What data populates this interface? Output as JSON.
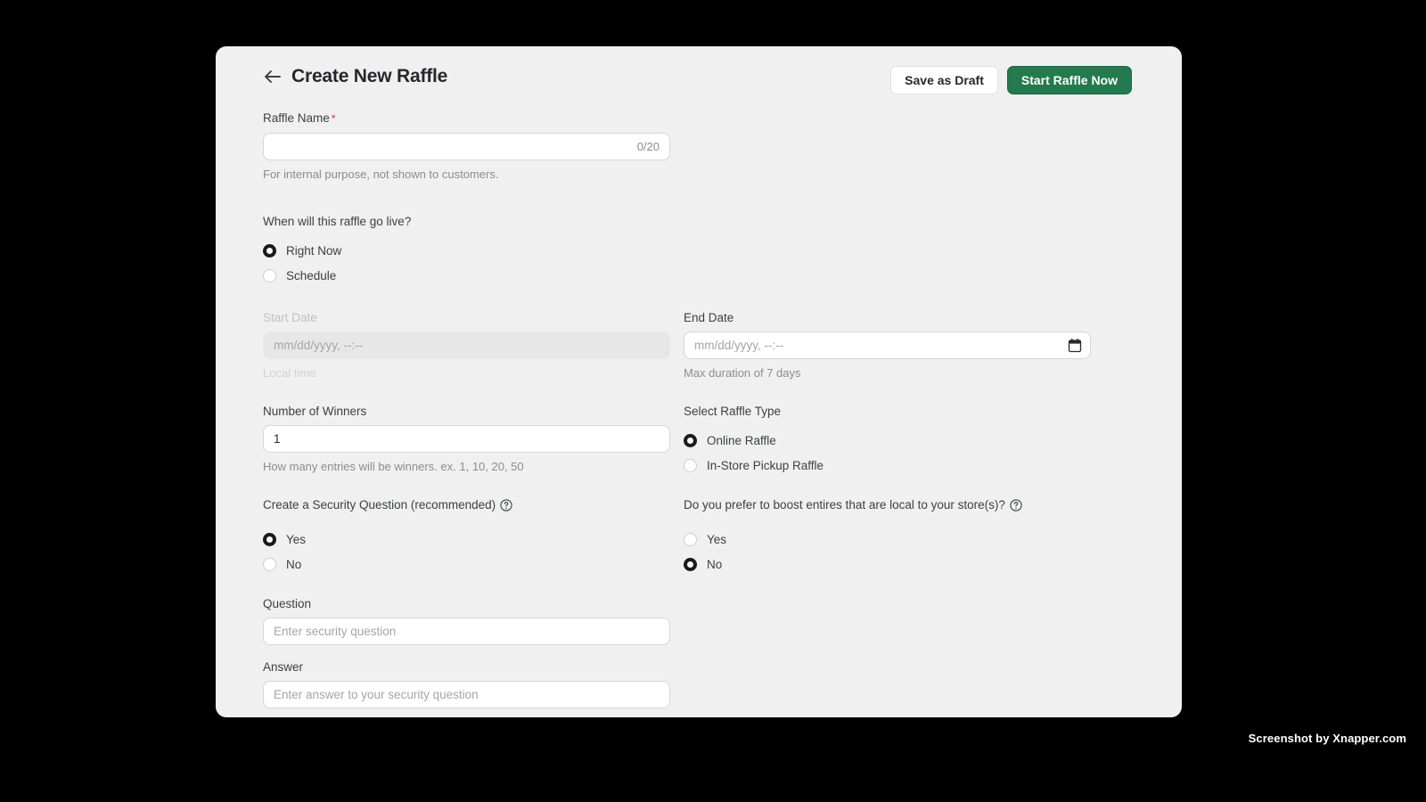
{
  "header": {
    "title": "Create New Raffle",
    "back_icon": "arrow-left-icon",
    "save_draft_label": "Save as Draft",
    "start_raffle_label": "Start Raffle Now",
    "primary_color": "#237a4e"
  },
  "raffle_name": {
    "label": "Raffle Name",
    "required_marker": "*",
    "value": "",
    "counter": "0/20",
    "help": "For internal purpose, not shown to customers."
  },
  "go_live": {
    "label": "When will this raffle go live?",
    "options": [
      {
        "label": "Right Now",
        "checked": true
      },
      {
        "label": "Schedule",
        "checked": false
      }
    ]
  },
  "start_date": {
    "label": "Start Date",
    "placeholder": "mm/dd/yyyy, --:--",
    "value": "",
    "help": "Local time",
    "disabled": true
  },
  "end_date": {
    "label": "End Date",
    "placeholder": "mm/dd/yyyy, --:--",
    "value": "",
    "help": "Max duration of 7 days",
    "icon": "calendar-icon",
    "disabled": false
  },
  "winners": {
    "label": "Number of Winners",
    "value": "1",
    "help": "How many entries will be winners. ex. 1, 10, 20, 50"
  },
  "raffle_type": {
    "label": "Select Raffle Type",
    "options": [
      {
        "label": "Online Raffle",
        "checked": true
      },
      {
        "label": "In-Store Pickup Raffle",
        "checked": false
      }
    ]
  },
  "security_question": {
    "label": "Create a Security Question (recommended)",
    "help_icon": "help-circle-icon",
    "options": [
      {
        "label": "Yes",
        "checked": true
      },
      {
        "label": "No",
        "checked": false
      }
    ]
  },
  "boost_local": {
    "label": "Do you prefer to boost entires that are local to your store(s)?",
    "help_icon": "help-circle-icon",
    "options": [
      {
        "label": "Yes",
        "checked": false
      },
      {
        "label": "No",
        "checked": true
      }
    ]
  },
  "question_field": {
    "label": "Question",
    "placeholder": "Enter security question",
    "value": ""
  },
  "answer_field": {
    "label": "Answer",
    "placeholder": "Enter answer to your security question",
    "value": ""
  },
  "watermark": {
    "text": "Screenshot by Xnapper.com"
  }
}
